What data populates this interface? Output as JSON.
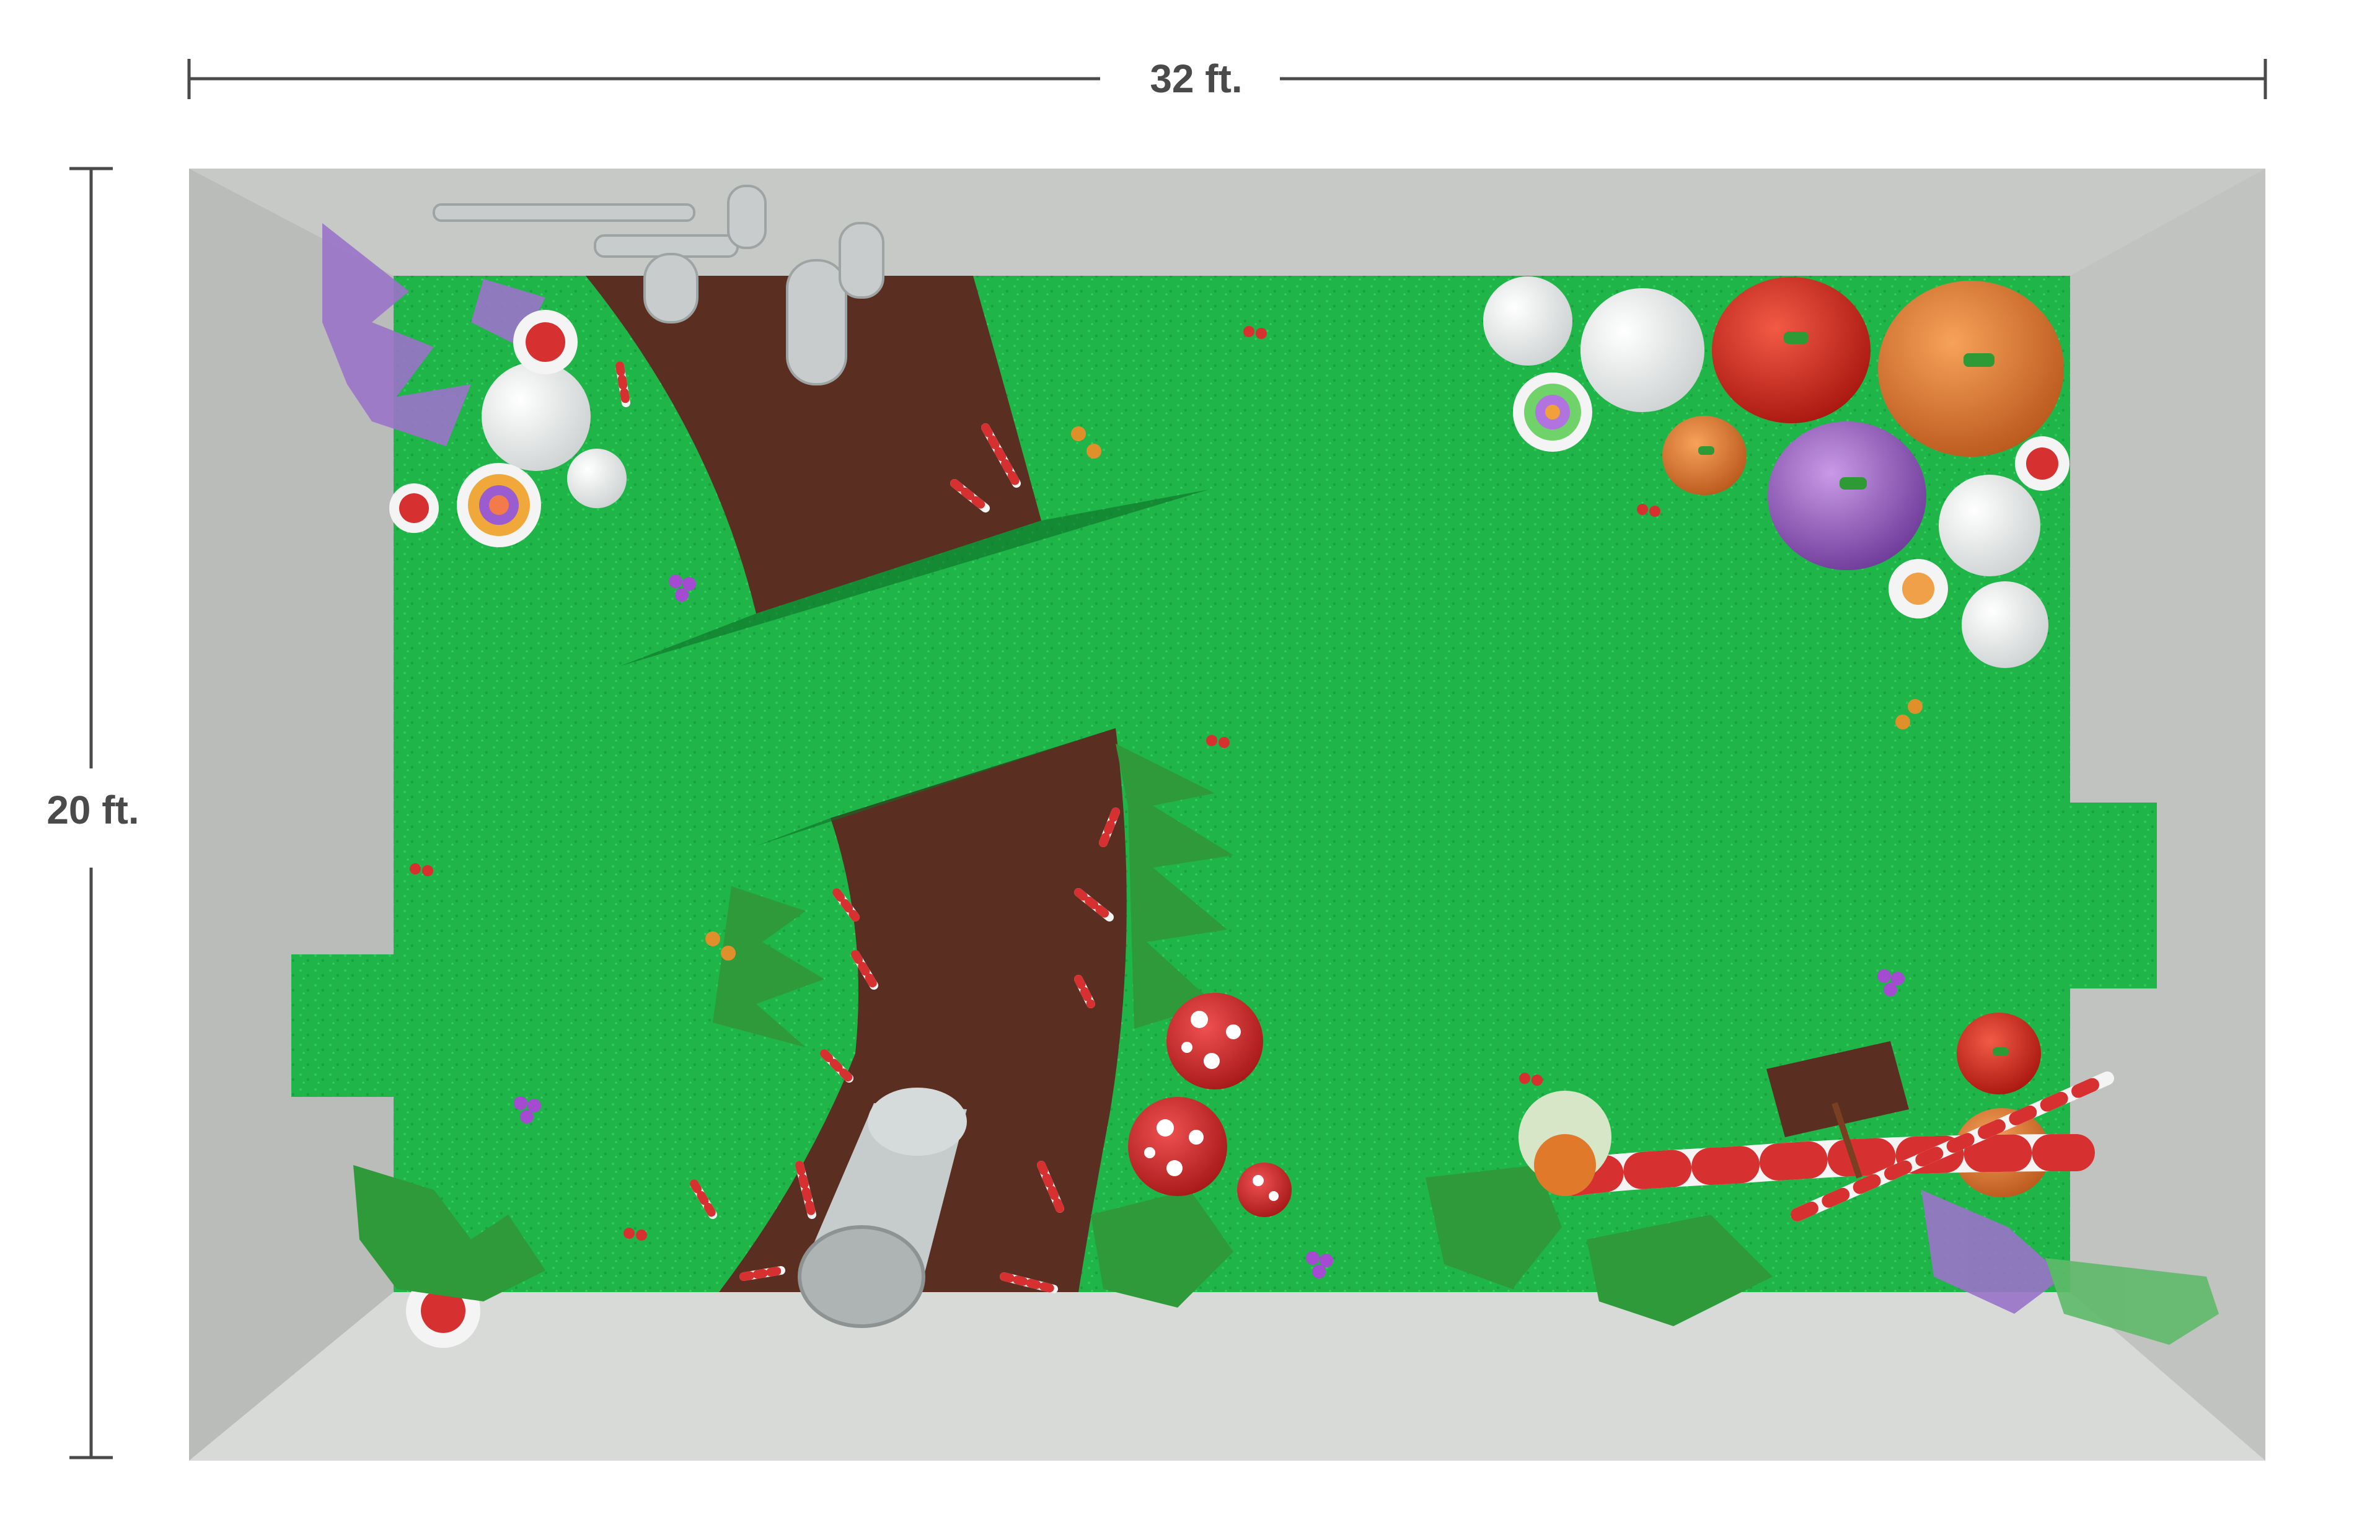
{
  "dimensions": {
    "width_label": "32 ft.",
    "height_label": "20 ft."
  },
  "room": {
    "width_ft": 32,
    "height_ft": 20
  },
  "colors": {
    "grass": "#1fb548",
    "grass_dark": "#138a33",
    "wall": "#cfd2cf",
    "wall_shadow": "#a9adaa",
    "path": "#5a2e20",
    "dimension_line": "#4a4a4a",
    "pumpkin_red": "#d42a22",
    "pumpkin_orange": "#e07a2a",
    "pumpkin_purple": "#9a5cc6",
    "mushroom_red": "#d42a2a",
    "candy_white": "#f4f4f4"
  },
  "objects": [
    "pipes",
    "brown-path",
    "pumpkins",
    "white-balls",
    "lollipops",
    "mushrooms",
    "candy-canes",
    "tube",
    "sign",
    "ferns",
    "purple-plants"
  ]
}
